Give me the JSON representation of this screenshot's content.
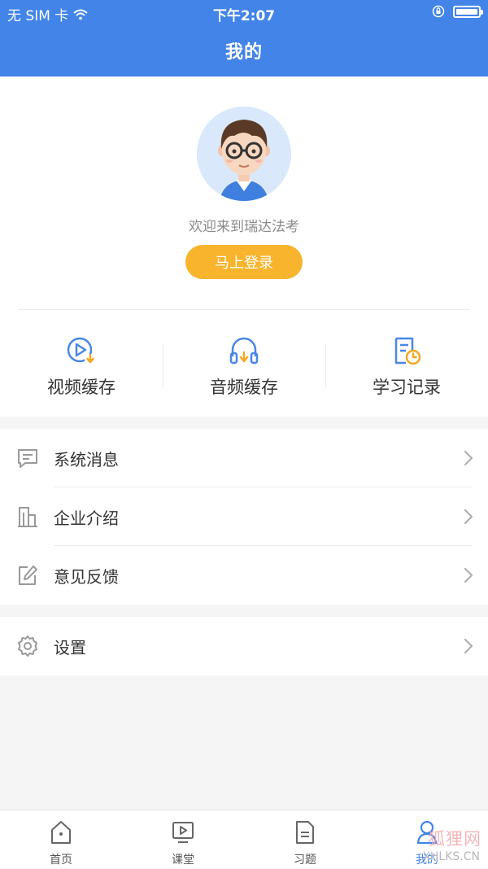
{
  "status_bar": {
    "carrier": "无 SIM 卡",
    "time": "下午2:07"
  },
  "header": {
    "title": "我的"
  },
  "profile": {
    "welcome": "欢迎来到瑞达法考",
    "login_button": "马上登录"
  },
  "quick_actions": [
    {
      "label": "视频缓存",
      "icon": "video-download-icon"
    },
    {
      "label": "音频缓存",
      "icon": "headphones-download-icon"
    },
    {
      "label": "学习记录",
      "icon": "study-record-icon"
    }
  ],
  "menu": [
    {
      "label": "系统消息",
      "icon": "message-icon"
    },
    {
      "label": "企业介绍",
      "icon": "building-icon"
    },
    {
      "label": "意见反馈",
      "icon": "edit-feedback-icon"
    }
  ],
  "settings": {
    "label": "设置",
    "icon": "gear-icon"
  },
  "tabs": [
    {
      "label": "首页",
      "icon": "home-icon"
    },
    {
      "label": "课堂",
      "icon": "classroom-icon"
    },
    {
      "label": "习题",
      "icon": "exercise-icon"
    },
    {
      "label": "我的",
      "icon": "user-icon",
      "active": true
    }
  ],
  "watermark": {
    "text": "狐狸网",
    "subtext": "XHLKS.CN"
  },
  "colors": {
    "primary": "#4284e8",
    "login_button": "#f7b42c",
    "icon_blue": "#4a86e8",
    "icon_orange": "#f5a623"
  }
}
